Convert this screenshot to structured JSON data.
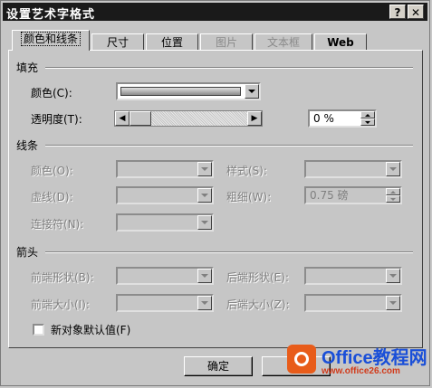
{
  "window": {
    "title": "设置艺术字格式",
    "help_btn": "?",
    "close_btn": "✕"
  },
  "tabs": [
    {
      "label": "颜色和线条",
      "active": true,
      "disabled": false
    },
    {
      "label": "尺寸",
      "active": false,
      "disabled": false
    },
    {
      "label": "位置",
      "active": false,
      "disabled": false
    },
    {
      "label": "图片",
      "active": false,
      "disabled": true
    },
    {
      "label": "文本框",
      "active": false,
      "disabled": true
    },
    {
      "label": "Web",
      "active": false,
      "disabled": false
    }
  ],
  "fill": {
    "section": "填充",
    "color_label": "颜色(C):",
    "transparency_label": "透明度(T):",
    "transparency_value": "0 %",
    "transparency_level": 0
  },
  "line": {
    "section": "线条",
    "color_label": "颜色(O):",
    "dashed_label": "虚线(D):",
    "connector_label": "连接符(N):",
    "style_label": "样式(S):",
    "weight_label": "粗细(W):",
    "weight_value": "0.75 磅"
  },
  "arrows": {
    "section": "箭头",
    "begin_style_label": "前端形状(B):",
    "begin_size_label": "前端大小(I):",
    "end_style_label": "后端形状(E):",
    "end_size_label": "后端大小(Z):"
  },
  "default_checkbox": "新对象默认值(F)",
  "buttons": {
    "ok": "确定"
  },
  "watermark": {
    "brand": "Office教程网",
    "url": "www.office26.com"
  }
}
